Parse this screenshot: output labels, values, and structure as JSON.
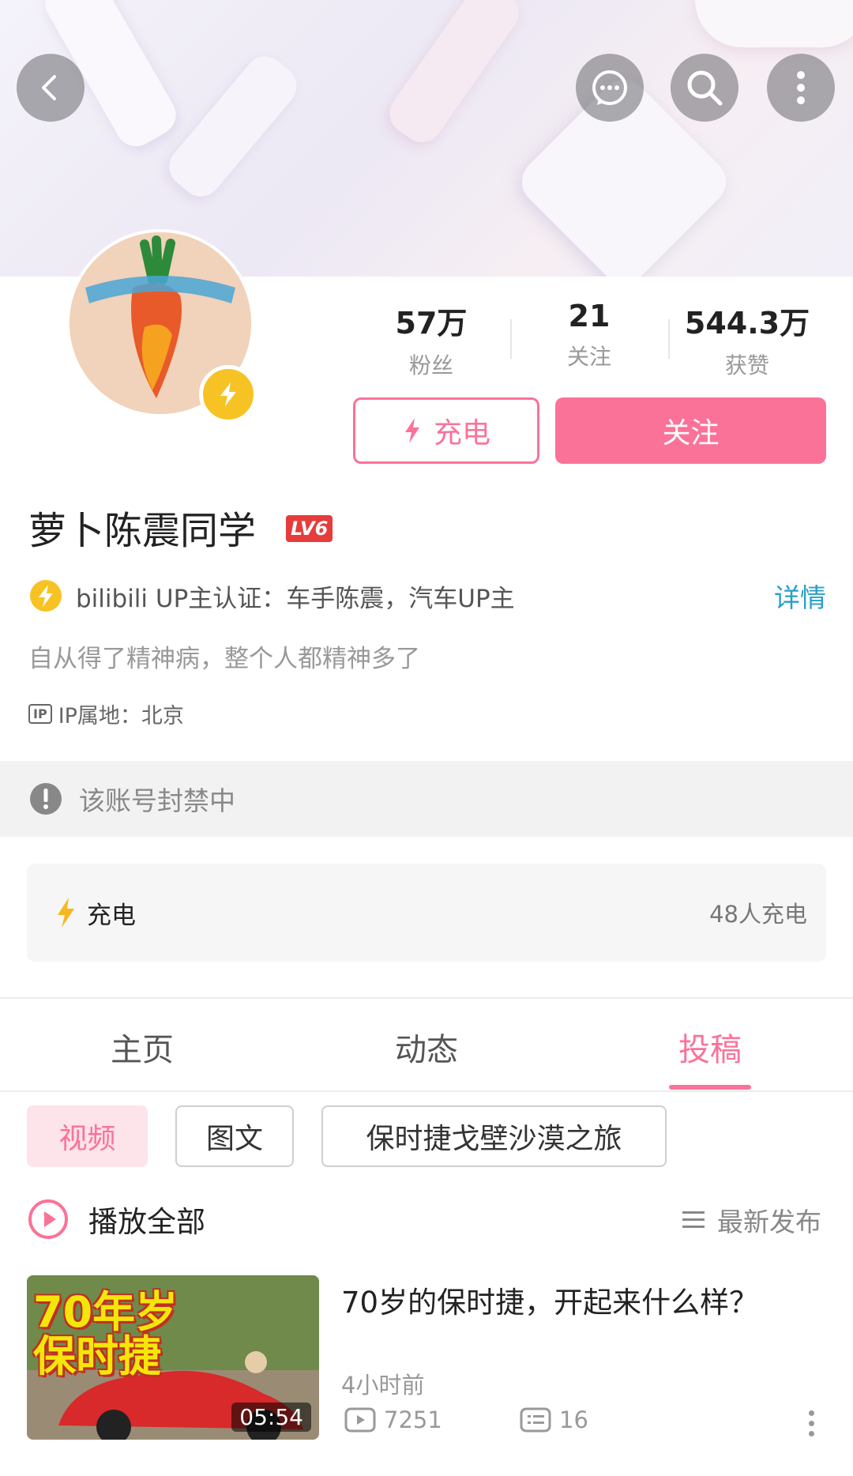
{
  "header": {
    "back_icon": "chevron-left-icon",
    "message_icon": "chat-bubble-icon",
    "search_icon": "search-icon",
    "more_icon": "more-vertical-icon"
  },
  "profile": {
    "stats": [
      {
        "value": "57万",
        "label": "粉丝"
      },
      {
        "value": "21",
        "label": "关注"
      },
      {
        "value": "544.3万",
        "label": "获赞"
      }
    ],
    "charge_button": "充电",
    "follow_button": "关注",
    "name": "萝卜陈震同学",
    "level": "LV6",
    "certification": "bilibili UP主认证：车手陈震，汽车UP主",
    "detail_link": "详情",
    "bio": "自从得了精神病，整个人都精神多了",
    "ip_badge": "IP",
    "ip_location": "IP属地：北京",
    "ban_notice": "该账号封禁中"
  },
  "charge_card": {
    "label": "充电",
    "count": "48人充电"
  },
  "tabs": [
    {
      "label": "主页",
      "active": false
    },
    {
      "label": "动态",
      "active": false
    },
    {
      "label": "投稿",
      "active": true
    }
  ],
  "filters": [
    {
      "label": "视频",
      "active": true
    },
    {
      "label": "图文",
      "active": false
    },
    {
      "label": "保时捷戈壁沙漠之旅",
      "active": false
    }
  ],
  "list_header": {
    "play_all": "播放全部",
    "sort": "最新发布"
  },
  "videos": [
    {
      "thumb_line1": "70年岁",
      "thumb_line2": "保时捷",
      "duration": "05:54",
      "title": "70岁的保时捷，开起来什么样？",
      "time": "4小时前",
      "plays": "7251",
      "comments": "16"
    }
  ],
  "colors": {
    "accent": "#fb7299",
    "link": "#2a9fc7",
    "badge_yellow": "#f7c324"
  }
}
